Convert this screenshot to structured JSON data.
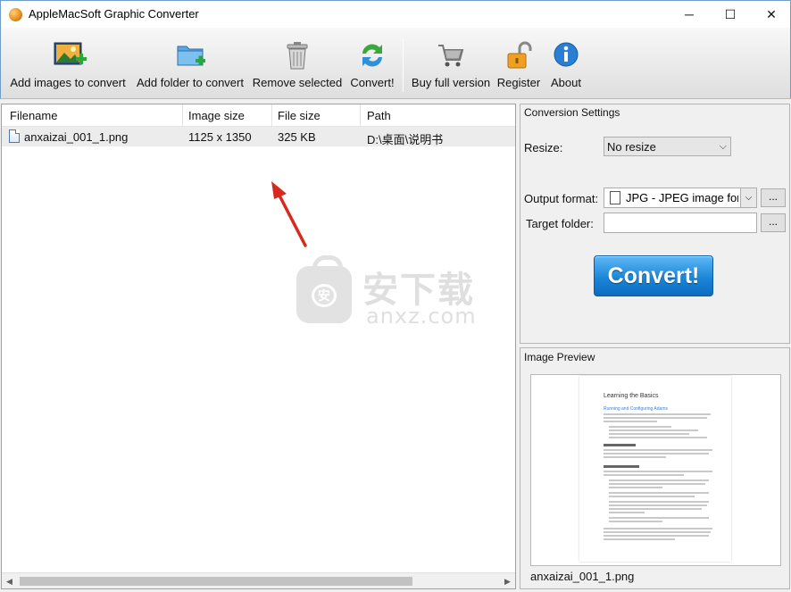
{
  "window": {
    "title": "AppleMacSoft Graphic Converter",
    "minimize": "─",
    "maximize": "☐",
    "close": "✕"
  },
  "toolbar": {
    "add_images": "Add images to convert",
    "add_folder": "Add folder to convert",
    "remove_selected": "Remove selected",
    "convert": "Convert!",
    "buy": "Buy full version",
    "register": "Register",
    "about": "About"
  },
  "file_list": {
    "columns": [
      "Filename",
      "Image size",
      "File size",
      "Path"
    ],
    "rows": [
      {
        "filename": "anxaizai_001_1.png",
        "image_size": "1125 x 1350",
        "file_size": "325 KB",
        "path": "D:\\桌面\\说明书"
      }
    ]
  },
  "watermark": {
    "cn": "安下载",
    "en": "anxz.com",
    "bag": "安"
  },
  "settings": {
    "title": "Conversion Settings",
    "resize_label": "Resize:",
    "resize_value": "No resize",
    "output_format_label": "Output format:",
    "output_format_value": "JPG - JPEG image form",
    "target_folder_label": "Target folder:",
    "target_folder_value": "",
    "browse_label": "...",
    "convert_button": "Convert!"
  },
  "preview": {
    "title": "Image Preview",
    "caption": "anxaizai_001_1.png",
    "doc_title": "Learning the Basics",
    "doc_subtitle": "Running and Configuring Adams"
  },
  "colors": {
    "accent_blue": "#1b86d8",
    "arrow_red": "#d9291e"
  }
}
